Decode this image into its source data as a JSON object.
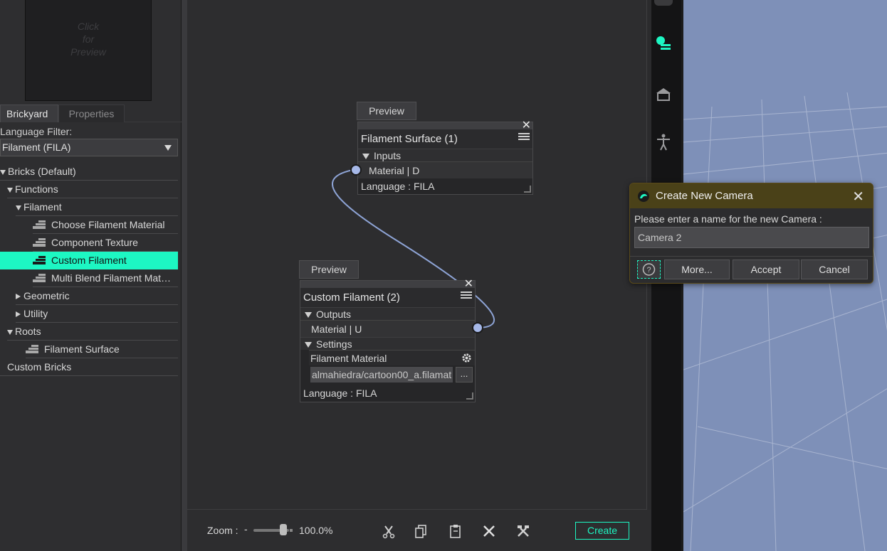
{
  "left_panel": {
    "preview_text": "Click\nfor\nPreview",
    "tabs": [
      "Brickyard",
      "Properties"
    ],
    "language_filter_label": "Language Filter:",
    "language_filter_value": "Filament (FILA)",
    "tree": [
      {
        "label": "Bricks (Default)",
        "level": 0,
        "expander": "down"
      },
      {
        "label": "Functions",
        "level": 1,
        "expander": "down"
      },
      {
        "label": "Filament",
        "level": 2,
        "expander": "down"
      },
      {
        "label": "Choose Filament Material",
        "level": 3,
        "icon": "brick-icon"
      },
      {
        "label": "Component Texture",
        "level": 3,
        "icon": "brick-icon"
      },
      {
        "label": "Custom Filament",
        "level": 3,
        "icon": "brick-icon",
        "selected": true
      },
      {
        "label": "Multi Blend Filament Mat…",
        "level": 3,
        "icon": "brick-icon"
      },
      {
        "label": "Geometric",
        "level": 2,
        "expander": "right"
      },
      {
        "label": "Utility",
        "level": 2,
        "expander": "right"
      },
      {
        "label": "Roots",
        "level": 1,
        "expander": "down"
      },
      {
        "label": "Filament Surface",
        "level": 2,
        "icon": "brick-icon"
      },
      {
        "label": "Custom Bricks",
        "level": 0
      }
    ]
  },
  "nodes": {
    "surface": {
      "preview_label": "Preview",
      "title": "Filament Surface (1)",
      "section": "Inputs",
      "port_label": "Material  | D",
      "language": "Language : FILA"
    },
    "custom": {
      "preview_label": "Preview",
      "title": "Custom Filament (2)",
      "section_outputs": "Outputs",
      "port_label": "Material  | U",
      "section_settings": "Settings",
      "setting_label": "Filament Material",
      "setting_value": "almahiedra/cartoon00_a.filamat",
      "browse_label": "...",
      "language": "Language : FILA"
    }
  },
  "toolbar": {
    "zoom_label": "Zoom :",
    "zoom_minus": "-",
    "zoom_value": "100.0%",
    "zoom_level": 1.0,
    "create_label": "Create"
  },
  "dialog": {
    "title": "Create New Camera",
    "prompt": "Please enter a name for the new Camera :",
    "input_value": "Camera 2",
    "buttons": {
      "more": "More...",
      "accept": "Accept",
      "cancel": "Cancel"
    }
  },
  "colors": {
    "accent": "#1df7c3",
    "dialog_title_bg": "#4a4118",
    "viewport_bg": "#7e90b8",
    "wire": "#8ea4d6"
  }
}
